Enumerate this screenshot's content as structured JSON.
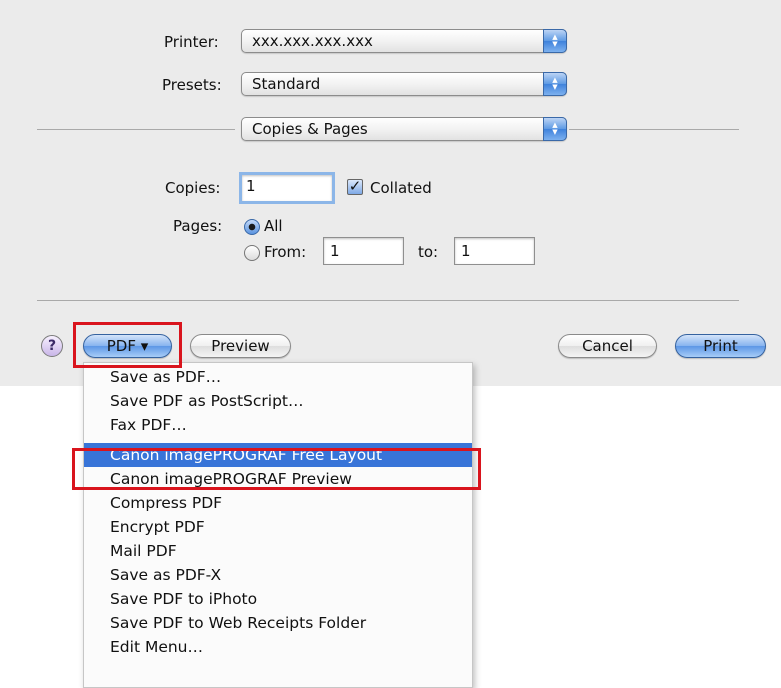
{
  "dialog": {
    "printer": {
      "label": "Printer:",
      "value": "xxx.xxx.xxx.xxx"
    },
    "presets": {
      "label": "Presets:",
      "value": "Standard"
    },
    "section": {
      "value": "Copies & Pages"
    },
    "copies": {
      "label": "Copies:",
      "value": "1",
      "collated_label": "Collated",
      "collated_checked": true
    },
    "pages": {
      "label": "Pages:",
      "all_label": "All",
      "from_label": "From:",
      "from_value": "1",
      "to_label": "to:",
      "to_value": "1",
      "selected": "All"
    },
    "buttons": {
      "help": "?",
      "pdf": "PDF ▾",
      "preview": "Preview",
      "cancel": "Cancel",
      "print": "Print"
    }
  },
  "pdf_menu": {
    "items": [
      "Save as PDF…",
      "Save PDF as PostScript…",
      "Fax PDF…",
      "Canon imagePROGRAF Free Layout",
      "Canon imagePROGRAF Preview",
      "Compress PDF",
      "Encrypt PDF",
      "Mail PDF",
      "Save as PDF-X",
      "Save PDF to iPhoto",
      "Save PDF to Web Receipts Folder",
      "Edit Menu…"
    ],
    "selected_item": "Canon imagePROGRAF Free Layout"
  },
  "colors": {
    "highlight": "#3874d8",
    "annotation": "#d9141d",
    "accent_button": "#5d97e6"
  }
}
